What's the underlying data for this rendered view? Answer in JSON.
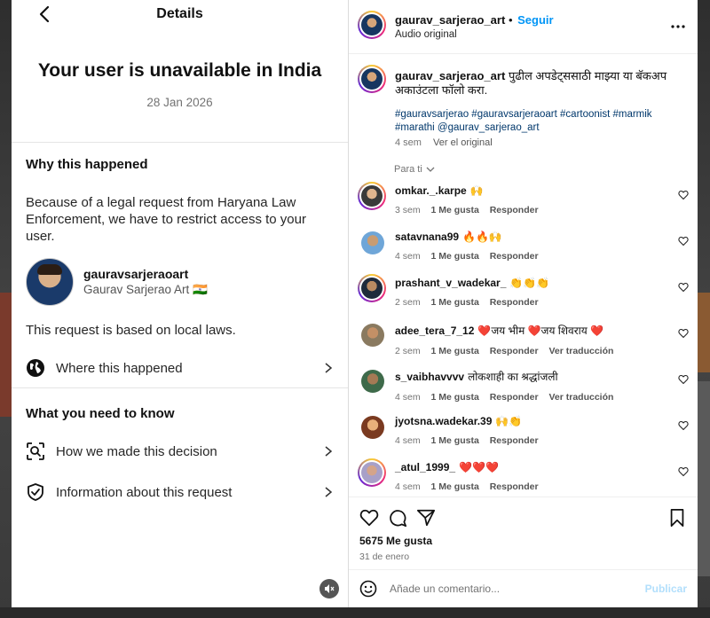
{
  "details": {
    "header_title": "Details",
    "title": "Your user is unavailable in India",
    "date": "28 Jan 2026",
    "why_title": "Why this happened",
    "reason": "Because of a legal request from Haryana Law Enforcement, we have to restrict access to your user.",
    "user": {
      "handle": "gauravsarjeraoart",
      "name": "Gaurav Sarjerao Art 🇮🇳"
    },
    "local_laws": "This request is based on local laws.",
    "where_label": "Where this happened",
    "need_title": "What you need to know",
    "how_label": "How we made this decision",
    "info_label": "Information about this request"
  },
  "post": {
    "username": "gaurav_sarjerao_art",
    "separator": "•",
    "follow_label": "Seguir",
    "audio": "Audio original",
    "caption_user": "gaurav_sarjerao_art",
    "caption_text": "पुढील अपडेट्ससाठी माझ्या या बॅकअप अकाउंटला फॉलो करा.",
    "hashtags": "#gauravsarjerao #gauravsarjeraoart #cartoonist #marmik #marathi @gaurav_sarjerao_art",
    "caption_age": "4 sem",
    "see_original": "Ver el original",
    "sort_label": "Para ti",
    "likes": "5675 Me gusta",
    "date": "31 de enero",
    "comment_placeholder": "Añade un comentario...",
    "publish_label": "Publicar"
  },
  "comments": [
    {
      "user": "omkar._.karpe",
      "text": "🙌",
      "age": "3 sem",
      "likes": "1 Me gusta",
      "reply": "Responder",
      "translate": ""
    },
    {
      "user": "satavnana99",
      "text": "🔥🔥🙌",
      "age": "4 sem",
      "likes": "1 Me gusta",
      "reply": "Responder",
      "translate": ""
    },
    {
      "user": "prashant_v_wadekar_",
      "text": "👏👏👏",
      "age": "2 sem",
      "likes": "1 Me gusta",
      "reply": "Responder",
      "translate": ""
    },
    {
      "user": "adee_tera_7_12",
      "text": "❤️जय भीम ❤️जय शिवराय ❤️",
      "age": "2 sem",
      "likes": "1 Me gusta",
      "reply": "Responder",
      "translate": "Ver traducción"
    },
    {
      "user": "s_vaibhavvvv",
      "text": "लोकशाही का श्रद्धांजली",
      "age": "4 sem",
      "likes": "1 Me gusta",
      "reply": "Responder",
      "translate": "Ver traducción"
    },
    {
      "user": "jyotsna.wadekar.39",
      "text": "🙌👏",
      "age": "4 sem",
      "likes": "1 Me gusta",
      "reply": "Responder",
      "translate": ""
    },
    {
      "user": "_atul_1999_",
      "text": "❤️❤️❤️",
      "age": "4 sem",
      "likes": "1 Me gusta",
      "reply": "Responder",
      "translate": ""
    }
  ],
  "colors": {
    "accent": "#0095f6",
    "link": "#00376b",
    "muted": "#737373",
    "publish_disabled": "#b2dffc"
  }
}
